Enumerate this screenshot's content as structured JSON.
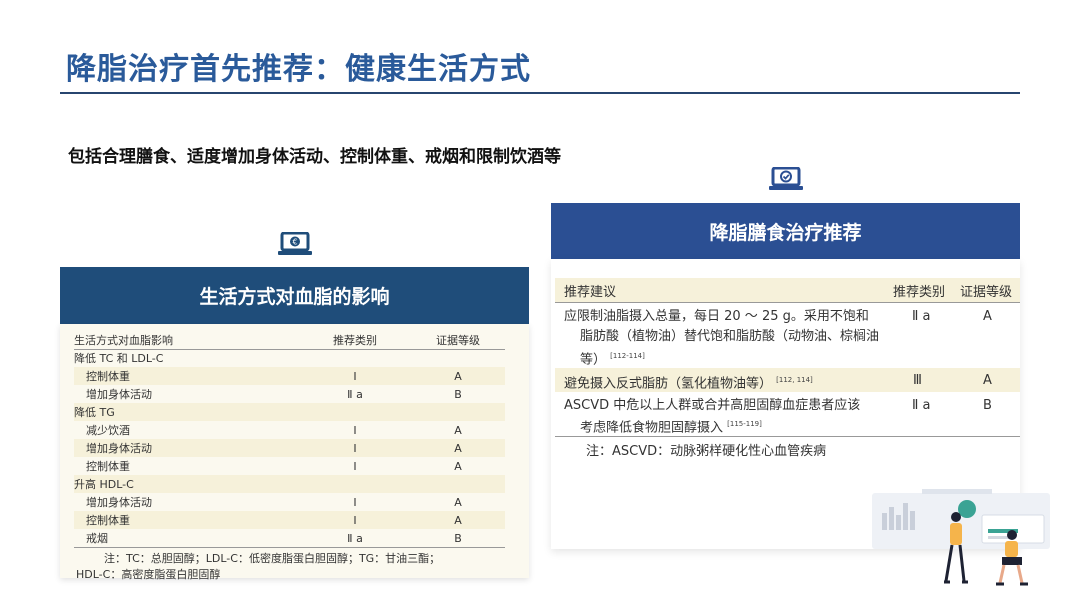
{
  "slide": {
    "title": "降脂治疗首先推荐：健康生活方式",
    "subtitle": "包括合理膳食、适度增加身体活动、控制体重、戒烟和限制饮酒等"
  },
  "left_panel": {
    "header": "生活方式对血脂的影响",
    "columns": [
      "生活方式对血脂影响",
      "推荐类别",
      "证据等级"
    ],
    "rows": [
      {
        "label": "降低 TC 和 LDL-C",
        "cls": "",
        "lvl": ""
      },
      {
        "label": "控制体重",
        "cls": "Ⅰ",
        "lvl": "A"
      },
      {
        "label": "增加身体活动",
        "cls": "Ⅱ a",
        "lvl": "B"
      },
      {
        "label": "降低 TG",
        "cls": "",
        "lvl": ""
      },
      {
        "label": "减少饮酒",
        "cls": "Ⅰ",
        "lvl": "A"
      },
      {
        "label": "增加身体活动",
        "cls": "Ⅰ",
        "lvl": "A"
      },
      {
        "label": "控制体重",
        "cls": "Ⅰ",
        "lvl": "A"
      },
      {
        "label": "升高 HDL-C",
        "cls": "",
        "lvl": ""
      },
      {
        "label": "增加身体活动",
        "cls": "Ⅰ",
        "lvl": "A"
      },
      {
        "label": "控制体重",
        "cls": "Ⅰ",
        "lvl": "A"
      },
      {
        "label": "戒烟",
        "cls": "Ⅱ a",
        "lvl": "B"
      }
    ],
    "note_line1": "注：TC：总胆固醇；LDL-C：低密度脂蛋白胆固醇；TG：甘油三酯；",
    "note_line2": "HDL-C：高密度脂蛋白胆固醇"
  },
  "right_panel": {
    "header": "降脂膳食治疗推荐",
    "columns": [
      "推荐建议",
      "推荐类别",
      "证据等级"
    ],
    "row1": {
      "line1": "应限制油脂摄入总量，每日 20 ～ 25 g。采用不饱和",
      "line2": "脂肪酸（植物油）替代饱和脂肪酸（动物油、棕榈油",
      "line3": "等）",
      "ref": "[112-114]",
      "cls": "Ⅱ a",
      "lvl": "A"
    },
    "row2": {
      "line1": "避免摄入反式脂肪（氢化植物油等）",
      "ref": "[112, 114]",
      "cls": "Ⅲ",
      "lvl": "A"
    },
    "row3": {
      "line1": "ASCVD 中危以上人群或合并高胆固醇血症患者应该",
      "line2": "考虑降低食物胆固醇摄入",
      "ref": "[115-119]",
      "cls": "Ⅱ a",
      "lvl": "B"
    },
    "note": "注：ASCVD：动脉粥样硬化性心血管疾病"
  },
  "icons": {
    "left_icon": "laptop-currency-icon",
    "right_icon": "laptop-check-icon"
  },
  "colors": {
    "title": "#2a5a9a",
    "left_header": "#1f4d7a",
    "right_header": "#2b4f93",
    "band": "#f6f1da"
  }
}
